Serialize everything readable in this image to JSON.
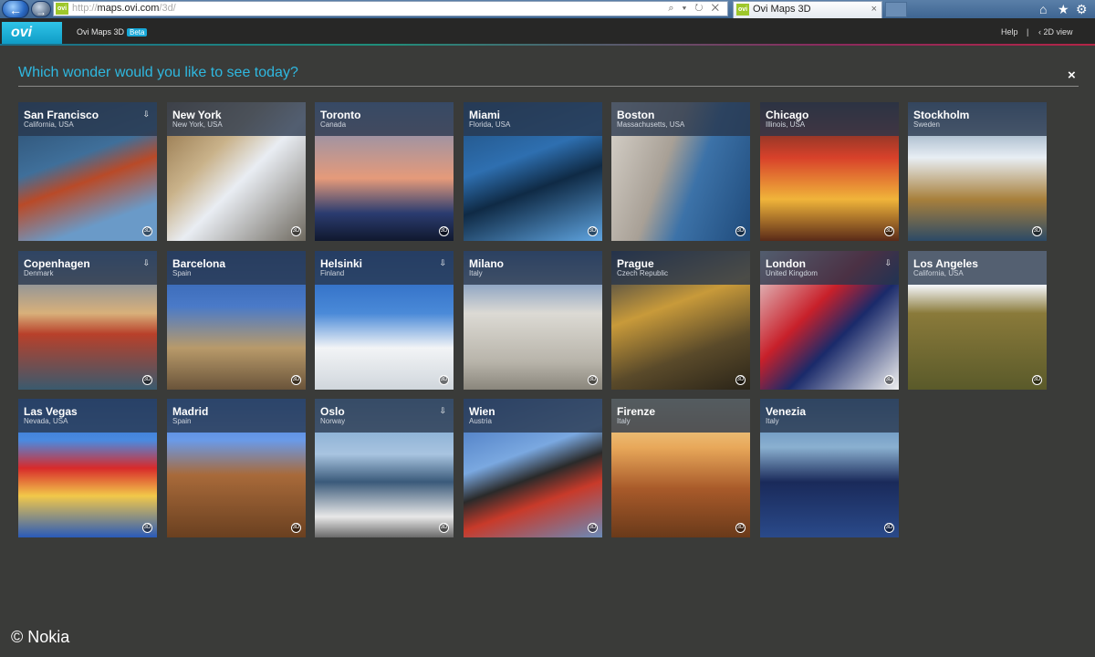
{
  "browser": {
    "url_prefix": "http://",
    "url_host": "maps.ovi.com",
    "url_path": "/3d/",
    "address_controls": "⌕ ▾ ↻ ✕",
    "favicon_text": "ovi",
    "tab_title": "Ovi Maps 3D",
    "tab_close": "×"
  },
  "app": {
    "logo_text": "ovi",
    "title": "Ovi Maps 3D",
    "beta_label": "Beta",
    "help_link": "Help",
    "separator": "|",
    "view_2d_link": "‹ 2D view"
  },
  "main": {
    "question": "Which wonder would you like to see today?",
    "close_label": "×"
  },
  "tiles": [
    {
      "city": "San Francisco",
      "country": "California, USA",
      "pin": true,
      "bg": "linear-gradient(160deg,#2a4a6a 0%,#3f6f9a 40%,#b94a28 55%,#6a9ac8 80%)"
    },
    {
      "city": "New York",
      "country": "New York, USA",
      "pin": false,
      "bg": "linear-gradient(135deg,#8a6a40 0%,#c9b28a 35%,#e9edf3 55%,#6f6a60 100%)"
    },
    {
      "city": "Toronto",
      "country": "Canada",
      "pin": false,
      "bg": "linear-gradient(180deg,#6e8fc0 0%,#e59a7a 55%,#2b3c70 80%,#10182e 100%)"
    },
    {
      "city": "Miami",
      "country": "Florida, USA",
      "pin": false,
      "bg": "linear-gradient(160deg,#1f4c7a 0%,#2e6fb0 40%,#0f2a45 60%,#5fa4e0 100%)"
    },
    {
      "city": "Boston",
      "country": "Massachusetts, USA",
      "pin": false,
      "bg": "linear-gradient(110deg,#d9d4cc 0%,#a8a096 40%,#3c72a8 60%,#1f4a7a 100%)"
    },
    {
      "city": "Chicago",
      "country": "Illinois, USA",
      "pin": false,
      "bg": "linear-gradient(180deg,#3a2a24 0%,#d8412a 40%,#f0b43a 70%,#5a2a18 100%)"
    },
    {
      "city": "Stockholm",
      "country": "Sweden",
      "pin": false,
      "bg": "linear-gradient(180deg,#5e7f9e 0%,#e8eef4 40%,#a8803c 70%,#2c4a66 100%)"
    },
    {
      "city": "Copenhagen",
      "country": "Denmark",
      "pin": true,
      "bg": "linear-gradient(180deg,#4a7ab8 0%,#d8b07a 45%,#b8402a 60%,#3a5a6e 100%)"
    },
    {
      "city": "Barcelona",
      "country": "Spain",
      "pin": false,
      "bg": "linear-gradient(180deg,#2a5aa8 0%,#4a7ac8 40%,#b89a6a 70%,#6a543a 100%)"
    },
    {
      "city": "Helsinki",
      "country": "Finland",
      "pin": true,
      "bg": "linear-gradient(180deg,#1f5ab8 0%,#4a8ad8 45%,#f2f4f6 70%,#d0d6dc 100%)"
    },
    {
      "city": "Milano",
      "country": "Italy",
      "pin": false,
      "bg": "linear-gradient(180deg,#3a6ab0 0%,#dcdad4 45%,#b8b4aa 80%,#8a867c 100%)"
    },
    {
      "city": "Prague",
      "country": "Czech Republic",
      "pin": false,
      "bg": "linear-gradient(160deg,#1a2a4a 0%,#c89a3a 40%,#5a4a2a 70%,#2a2418 100%)"
    },
    {
      "city": "London",
      "country": "United Kingdom",
      "pin": true,
      "bg": "linear-gradient(135deg,#e8e8e8 0%,#c8202a 40%,#1a2a6a 60%,#f0f0f0 100%)"
    },
    {
      "city": "Los Angeles",
      "country": "California, USA",
      "pin": false,
      "bg": "linear-gradient(180deg,#f2f4f6 0%,#f2f4f6 25%,#8a7a3a 45%,#5a5a2a 100%)"
    },
    {
      "city": "Las Vegas",
      "country": "Nevada, USA",
      "pin": false,
      "bg": "linear-gradient(180deg,#2a6ac8 0%,#4a8ae0 30%,#d82a2a 50%,#f2c84a 70%,#2a5ab8 100%)"
    },
    {
      "city": "Madrid",
      "country": "Spain",
      "pin": false,
      "bg": "linear-gradient(180deg,#3a7ad8 0%,#6a9ae8 30%,#a86a3a 55%,#6a4020 100%)"
    },
    {
      "city": "Oslo",
      "country": "Norway",
      "pin": true,
      "bg": "linear-gradient(180deg,#6a9ac8 0%,#a8c4e0 40%,#3a5a7a 60%,#e8e8e8 85%,#6a6a6a 100%)"
    },
    {
      "city": "Wien",
      "country": "Austria",
      "pin": false,
      "bg": "linear-gradient(160deg,#3a6ab8 0%,#7aa8e0 40%,#2a2a2a 55%,#c83a2a 70%,#6a8ab8 100%)"
    },
    {
      "city": "Firenze",
      "country": "Italy",
      "pin": false,
      "bg": "linear-gradient(180deg,#f2e2a8 0%,#e8a85a 35%,#a85a2a 65%,#6a3a1a 100%)"
    },
    {
      "city": "Venezia",
      "country": "Italy",
      "pin": false,
      "bg": "linear-gradient(180deg,#4a7ab0 0%,#8ab0d0 35%,#1a2a5a 60%,#2a4a8a 100%)"
    }
  ],
  "tile_banner_pin_icon": "⇩",
  "tile_badge_text": "3D",
  "footer": {
    "copyright": "© Nokia"
  },
  "colors": {
    "accent": "#2fb8e0",
    "background": "#3a3b39",
    "header": "#272726",
    "logo": "#17a8d8"
  }
}
